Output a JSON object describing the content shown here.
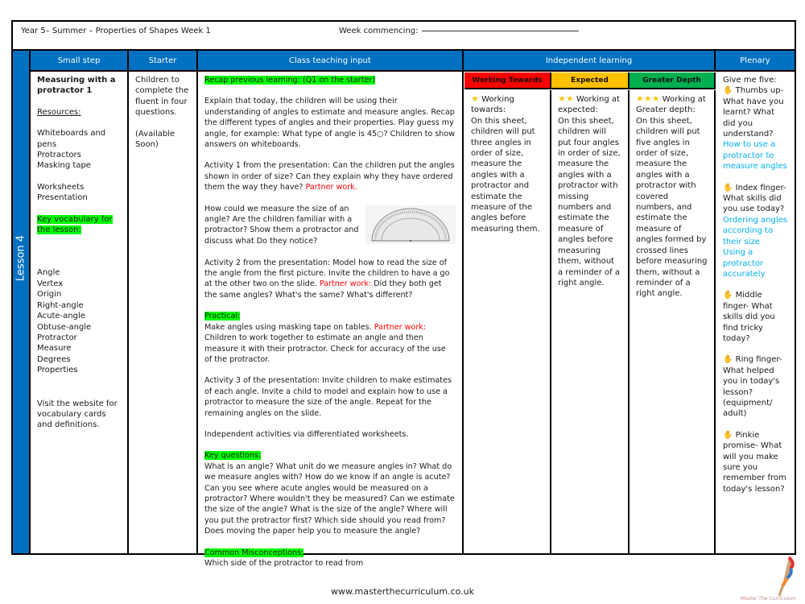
{
  "header": {
    "title": "Year 5– Summer – Properties of Shapes Week 1",
    "week_commencing_label": "Week commencing:"
  },
  "lesson_label": "Lesson 4",
  "columns": {
    "small_step": "Small step",
    "starter": "Starter",
    "class_teaching": "Class teaching input",
    "independent": "Independent learning",
    "plenary": "Plenary"
  },
  "colors": {
    "header_blue": "#0070C0",
    "working_towards": "#FF0000",
    "expected": "#FFC000",
    "greater_depth": "#00B050",
    "highlight": "#00FF00",
    "partner_red": "#FF0000",
    "plenary_blue": "#00B0F0"
  },
  "small_step": {
    "title": "Measuring with a protractor 1",
    "resources_label": "Resources:",
    "resources_group1": [
      "Whiteboards and pens",
      "Protractors",
      "Masking tape"
    ],
    "resources_group2": [
      "Worksheets",
      "Presentation"
    ],
    "vocab_label": "Key vocabulary for the lesson:",
    "vocab": [
      "Angle",
      "Vertex",
      "Origin",
      "Right-angle",
      "Acute-angle",
      "Obtuse-angle",
      "Protractor",
      "Measure",
      "Degrees",
      "Properties"
    ],
    "website_note": "Visit the website for vocabulary cards and definitions."
  },
  "starter": {
    "text": "Children to complete the fluent in four questions.",
    "note": "(Available Soon)"
  },
  "teaching": {
    "recap": "Recap previous learning: (Q1 on the starter)",
    "explain": "Explain that today, the children will be using their understanding of angles to estimate and measure angles. Recap the different types of angles and their properties. Play guess my angle, for example: What type of angle is 45○? Children to show answers on whiteboards.",
    "activity1": "Activity 1 from the presentation: Can the children put the angles shown in order of size? Can they explain why they have ordered them the way they have?",
    "partner_work": "Partner work.",
    "partner_work_colon": "Partner work:",
    "protractor_q": "How could we measure the size of an angle? Are the children familiar with a protractor? Show them a protractor and  discuss what Do they notice?",
    "activity2_a": "Activity 2 from the presentation: Model how to read the size of the angle from the first picture. Invite the children to have a go at the other two on the slide.",
    "activity2_b": "Did they both get the same angles? What's the same? What's different?",
    "practical_label": "Practical:",
    "practical_a": "Make angles using masking tape on tables.",
    "practical_b": "Children to work together to estimate an angle and then measure it with their protractor. Check for accuracy of the use of the protractor.",
    "activity3": "Activity 3 of the presentation: Invite children to make estimates of each angle. Invite a child to model and explain how to use a protractor to measure the size of the angle. Repeat for the remaining angles on the slide.",
    "independent_note": "Independent activities via differentiated worksheets.",
    "key_questions_label": "Key questions:",
    "key_questions": "What is an angle? What unit do we measure angles in? What do we measure angles with? How do we know if an angle is acute? Can you see where acute angles would be measured on a protractor? Where wouldn't they be measured? Can we estimate the size of the angle? What is the size of the angle? Where will you put the protractor first? Which side should you read from? Does moving the paper help you to measure the angle?",
    "misconceptions_label": "Common Misconceptions:",
    "misconceptions": "Which side of the protractor to read from"
  },
  "independent": {
    "levels": [
      {
        "label": "Working Towards",
        "stars": "★",
        "heading": "Working towards:",
        "text": "On this sheet, children will put three angles in order of size, measure the angles with a protractor and estimate the measure of the angles before measuring them."
      },
      {
        "label": "Expected",
        "stars": "★★",
        "heading": "Working at expected:",
        "text": "On this sheet, children will put four angles in order of size, measure the angles with a protractor with missing numbers and estimate the measure of angles before measuring them, without a reminder of a right angle."
      },
      {
        "label": "Greater Depth",
        "stars": "★★★",
        "heading": "Working at Greater depth:",
        "text": "On this sheet, children will put five angles in order of size, measure the angles with a protractor with covered numbers, and estimate the measure of angles formed by crossed lines before measuring them, without a reminder of a right angle."
      }
    ]
  },
  "plenary": {
    "intro": "Give me five:",
    "items": [
      {
        "prompt": "Thumbs up- What have you learnt? What did you understand?",
        "answers": [
          "How to use a protractor to measure angles"
        ]
      },
      {
        "prompt": "Index finger- What skills did you use today?",
        "answers": [
          "Ordering angles according to their size",
          "Using a protractor accurately"
        ]
      },
      {
        "prompt": "Middle finger- What skills did you find tricky today?",
        "answers": []
      },
      {
        "prompt": "Ring finger- What helped you in today's lesson? (equipment/ adult)",
        "answers": []
      },
      {
        "prompt": "Pinkie promise- What will you make sure you remember from today's lesson?",
        "answers": []
      }
    ]
  },
  "footer": {
    "url": "www.masterthecurriculum.co.uk",
    "logo_text": "Master The Curriculum"
  }
}
